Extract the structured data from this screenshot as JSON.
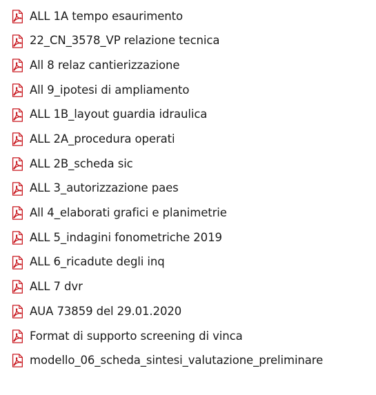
{
  "file_list": {
    "icon": "pdf-document-icon",
    "icon_color": "#c8161d",
    "items": [
      {
        "name": "ALL 1A tempo esaurimento"
      },
      {
        "name": "22_CN_3578_VP relazione tecnica"
      },
      {
        "name": "All 8 relaz cantierizzazione"
      },
      {
        "name": "All 9_ipotesi di ampliamento"
      },
      {
        "name": "ALL 1B_layout guardia idraulica"
      },
      {
        "name": "ALL 2A_procedura operati"
      },
      {
        "name": "ALL 2B_scheda sic"
      },
      {
        "name": "ALL 3_autorizzazione paes"
      },
      {
        "name": "All 4_elaborati grafici e planimetrie"
      },
      {
        "name": "ALL 5_indagini fonometriche 2019"
      },
      {
        "name": "ALL 6_ricadute degli inq"
      },
      {
        "name": "ALL 7 dvr"
      },
      {
        "name": "AUA 73859 del 29.01.2020"
      },
      {
        "name": "Format di supporto screening di vinca"
      },
      {
        "name": "modello_06_scheda_sintesi_valutazione_preliminare"
      }
    ]
  }
}
